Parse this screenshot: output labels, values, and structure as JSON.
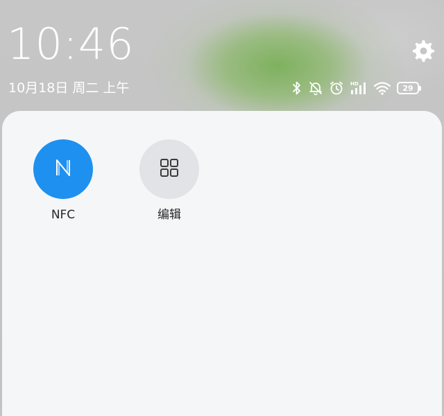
{
  "statusbar": {
    "time": "10:46",
    "date": "10月18日 周二 上午",
    "battery_level": "29",
    "icons": [
      "bluetooth-icon",
      "silent-bell-icon",
      "alarm-icon",
      "hd-signal-icon",
      "wifi-icon",
      "battery-icon",
      "settings-gear-icon"
    ]
  },
  "quick_settings": {
    "tiles": [
      {
        "label": "NFC",
        "icon": "nfc-icon",
        "active": true,
        "color": "#1e90f0"
      },
      {
        "label": "编辑",
        "icon": "grid-edit-icon",
        "active": false,
        "color": "#e2e3e6"
      }
    ]
  }
}
